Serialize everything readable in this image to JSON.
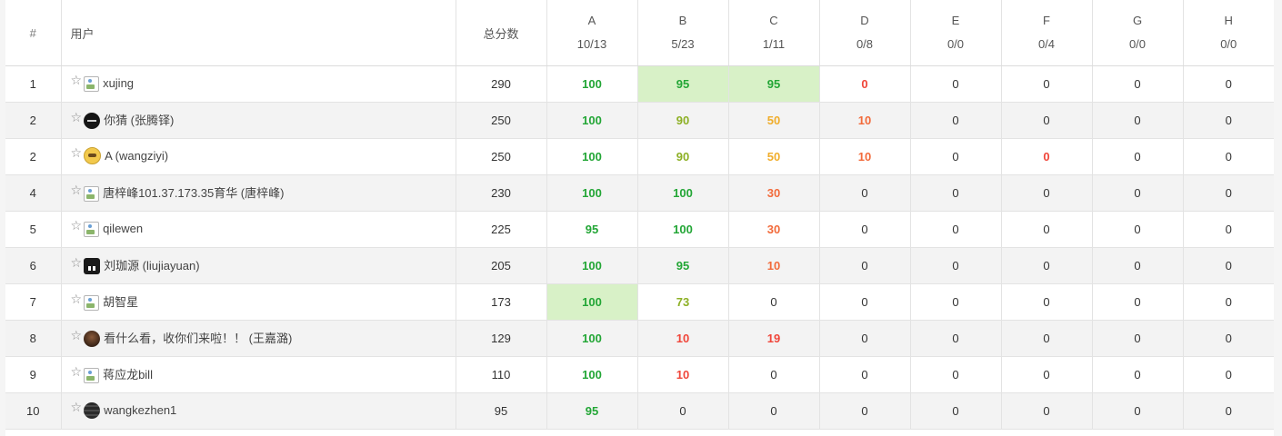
{
  "header": {
    "rank": "#",
    "user": "用户",
    "score": "总分数",
    "problems": [
      {
        "letter": "A",
        "stat": "10/13"
      },
      {
        "letter": "B",
        "stat": "5/23"
      },
      {
        "letter": "C",
        "stat": "1/11"
      },
      {
        "letter": "D",
        "stat": "0/8"
      },
      {
        "letter": "E",
        "stat": "0/0"
      },
      {
        "letter": "F",
        "stat": "0/4"
      },
      {
        "letter": "G",
        "stat": "0/0"
      },
      {
        "letter": "H",
        "stat": "0/0"
      }
    ]
  },
  "colors": {
    "full": "#23a636",
    "high": "#8db025",
    "mid": "#f0ad2b",
    "low": "#f26a3a",
    "fail": "#f0463a",
    "first_solve_bg": "#d8f1c7"
  },
  "rows": [
    {
      "rank": "1",
      "avatar": "broken-image-icon",
      "name": "xujing",
      "total": "290",
      "scores": [
        {
          "v": "100",
          "c": "green"
        },
        {
          "v": "95",
          "c": "green",
          "first": true
        },
        {
          "v": "95",
          "c": "green",
          "first": true
        },
        {
          "v": "0",
          "c": "red"
        },
        {
          "v": "0",
          "c": "plain"
        },
        {
          "v": "0",
          "c": "plain"
        },
        {
          "v": "0",
          "c": "plain"
        },
        {
          "v": "0",
          "c": "plain"
        }
      ]
    },
    {
      "rank": "2",
      "avatar": "dark-round-avatar-icon",
      "name": "你猜 (张腾铎)",
      "total": "250",
      "scores": [
        {
          "v": "100",
          "c": "green"
        },
        {
          "v": "90",
          "c": "olive"
        },
        {
          "v": "50",
          "c": "amber"
        },
        {
          "v": "10",
          "c": "orange"
        },
        {
          "v": "0",
          "c": "plain"
        },
        {
          "v": "0",
          "c": "plain"
        },
        {
          "v": "0",
          "c": "plain"
        },
        {
          "v": "0",
          "c": "plain"
        }
      ]
    },
    {
      "rank": "2",
      "avatar": "cartoon-avatar-icon",
      "name": "A (wangziyi)",
      "total": "250",
      "scores": [
        {
          "v": "100",
          "c": "green"
        },
        {
          "v": "90",
          "c": "olive"
        },
        {
          "v": "50",
          "c": "amber"
        },
        {
          "v": "10",
          "c": "orange"
        },
        {
          "v": "0",
          "c": "plain"
        },
        {
          "v": "0",
          "c": "red"
        },
        {
          "v": "0",
          "c": "plain"
        },
        {
          "v": "0",
          "c": "plain"
        }
      ]
    },
    {
      "rank": "4",
      "avatar": "broken-image-icon",
      "name": "唐梓峰101.37.173.35育华 (唐梓峰)",
      "total": "230",
      "scores": [
        {
          "v": "100",
          "c": "green"
        },
        {
          "v": "100",
          "c": "green"
        },
        {
          "v": "30",
          "c": "orange"
        },
        {
          "v": "0",
          "c": "plain"
        },
        {
          "v": "0",
          "c": "plain"
        },
        {
          "v": "0",
          "c": "plain"
        },
        {
          "v": "0",
          "c": "plain"
        },
        {
          "v": "0",
          "c": "plain"
        }
      ]
    },
    {
      "rank": "5",
      "avatar": "broken-image-icon",
      "name": "qilewen",
      "total": "225",
      "scores": [
        {
          "v": "95",
          "c": "green"
        },
        {
          "v": "100",
          "c": "green"
        },
        {
          "v": "30",
          "c": "orange"
        },
        {
          "v": "0",
          "c": "plain"
        },
        {
          "v": "0",
          "c": "plain"
        },
        {
          "v": "0",
          "c": "plain"
        },
        {
          "v": "0",
          "c": "plain"
        },
        {
          "v": "0",
          "c": "plain"
        }
      ]
    },
    {
      "rank": "6",
      "avatar": "square-avatar-icon",
      "name": "刘珈源 (liujiayuan)",
      "total": "205",
      "scores": [
        {
          "v": "100",
          "c": "green"
        },
        {
          "v": "95",
          "c": "green"
        },
        {
          "v": "10",
          "c": "orange"
        },
        {
          "v": "0",
          "c": "plain"
        },
        {
          "v": "0",
          "c": "plain"
        },
        {
          "v": "0",
          "c": "plain"
        },
        {
          "v": "0",
          "c": "plain"
        },
        {
          "v": "0",
          "c": "plain"
        }
      ]
    },
    {
      "rank": "7",
      "avatar": "broken-image-icon",
      "name": "胡智星",
      "total": "173",
      "scores": [
        {
          "v": "100",
          "c": "green",
          "first": true
        },
        {
          "v": "73",
          "c": "olive"
        },
        {
          "v": "0",
          "c": "plain"
        },
        {
          "v": "0",
          "c": "plain"
        },
        {
          "v": "0",
          "c": "plain"
        },
        {
          "v": "0",
          "c": "plain"
        },
        {
          "v": "0",
          "c": "plain"
        },
        {
          "v": "0",
          "c": "plain"
        }
      ]
    },
    {
      "rank": "8",
      "avatar": "brown-photo-avatar-icon",
      "name": "看什么看，收你们来啦！！ (王嘉潞)",
      "total": "129",
      "scores": [
        {
          "v": "100",
          "c": "green"
        },
        {
          "v": "10",
          "c": "red"
        },
        {
          "v": "19",
          "c": "red"
        },
        {
          "v": "0",
          "c": "plain"
        },
        {
          "v": "0",
          "c": "plain"
        },
        {
          "v": "0",
          "c": "plain"
        },
        {
          "v": "0",
          "c": "plain"
        },
        {
          "v": "0",
          "c": "plain"
        }
      ]
    },
    {
      "rank": "9",
      "avatar": "broken-image-icon",
      "name": "蒋应龙bill",
      "total": "110",
      "scores": [
        {
          "v": "100",
          "c": "green"
        },
        {
          "v": "10",
          "c": "red"
        },
        {
          "v": "0",
          "c": "plain"
        },
        {
          "v": "0",
          "c": "plain"
        },
        {
          "v": "0",
          "c": "plain"
        },
        {
          "v": "0",
          "c": "plain"
        },
        {
          "v": "0",
          "c": "plain"
        },
        {
          "v": "0",
          "c": "plain"
        }
      ]
    },
    {
      "rank": "10",
      "avatar": "striped-photo-avatar-icon",
      "name": "wangkezhen1",
      "total": "95",
      "scores": [
        {
          "v": "95",
          "c": "green"
        },
        {
          "v": "0",
          "c": "plain"
        },
        {
          "v": "0",
          "c": "plain"
        },
        {
          "v": "0",
          "c": "plain"
        },
        {
          "v": "0",
          "c": "plain"
        },
        {
          "v": "0",
          "c": "plain"
        },
        {
          "v": "0",
          "c": "plain"
        },
        {
          "v": "0",
          "c": "plain"
        }
      ]
    }
  ]
}
